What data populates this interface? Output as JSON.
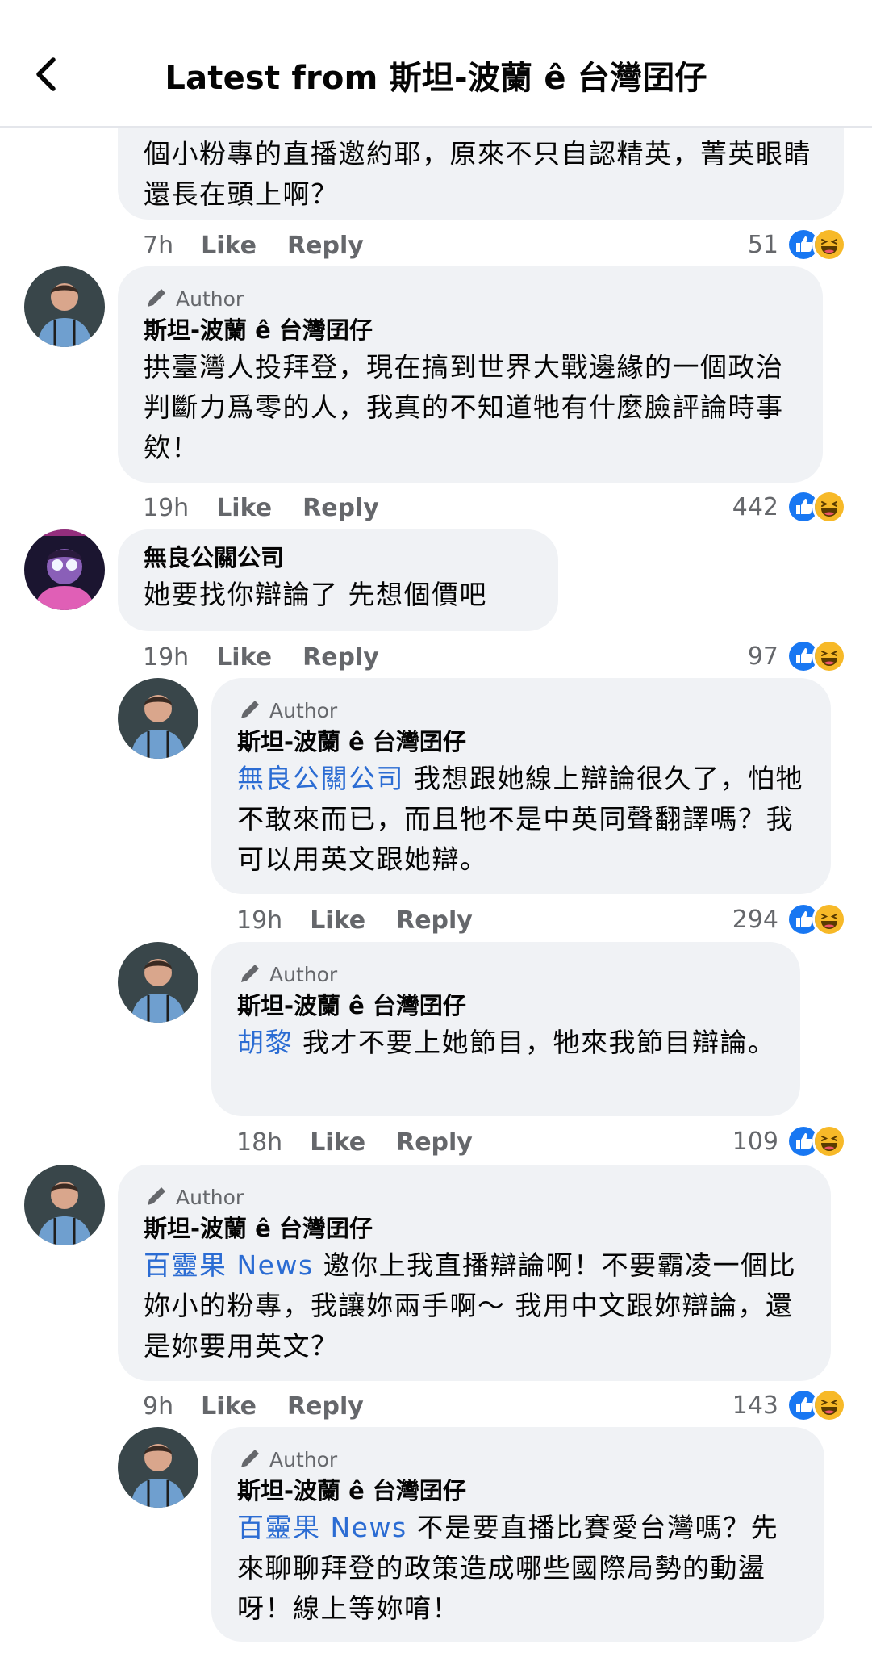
{
  "header": {
    "title": "Latest from 斯坦-波蘭 ê 台灣囝仔"
  },
  "colors": {
    "like_blue": "#1877f2",
    "haha_yellow": "#f7b928",
    "mention_blue": "#2b6cd3",
    "bubble_bg": "#f0f2f5",
    "meta_gray": "#65676b"
  },
  "icons": {
    "back": "chevron-left-icon",
    "author": "pen-icon",
    "like": "like-reaction-icon",
    "haha": "haha-reaction-icon"
  },
  "labels": {
    "like": "Like",
    "reply": "Reply",
    "author_badge": "Author"
  },
  "comments": [
    {
      "text": "個小粉專的直播邀約耶，原來不只自認精英，菁英眼睛還長在頭上啊？",
      "time": "7h",
      "reactions": "51"
    },
    {
      "author": "斯坦-波蘭 ê 台灣囝仔",
      "is_author": true,
      "text": "拱臺灣人投拜登，現在搞到世界大戰邊緣的一個政治判斷力爲零的人，我真的不知道牠有什麼臉評論時事欸！",
      "time": "19h",
      "reactions": "442"
    },
    {
      "author": "無良公關公司",
      "text": "她要找你辯論了  先想個價吧",
      "time": "19h",
      "reactions": "97"
    },
    {
      "author": "斯坦-波蘭 ê 台灣囝仔",
      "is_author": true,
      "mention": "無良公關公司",
      "text": " 我想跟她線上辯論很久了，怕牠不敢來而已，而且牠不是中英同聲翻譯嗎？我可以用英文跟她辯。",
      "time": "19h",
      "reactions": "294"
    },
    {
      "author": "斯坦-波蘭 ê 台灣囝仔",
      "is_author": true,
      "mention": "胡黎",
      "text": " 我才不要上她節目，牠來我節目辯論。",
      "time": "18h",
      "reactions": "109"
    },
    {
      "author": "斯坦-波蘭 ê 台灣囝仔",
      "is_author": true,
      "mention": "百靈果 News",
      "text": " 邀你上我直播辯論啊！不要霸凌一個比妳小的粉專，我讓妳兩手啊～ 我用中文跟妳辯論，還是妳要用英文？",
      "time": "9h",
      "reactions": "143"
    },
    {
      "author": "斯坦-波蘭 ê 台灣囝仔",
      "is_author": true,
      "mention": "百靈果 News",
      "text": " 不是要直播比賽愛台灣嗎？先來聊聊拜登的政策造成哪些國際局勢的動盪呀！線上等妳唷！"
    }
  ]
}
